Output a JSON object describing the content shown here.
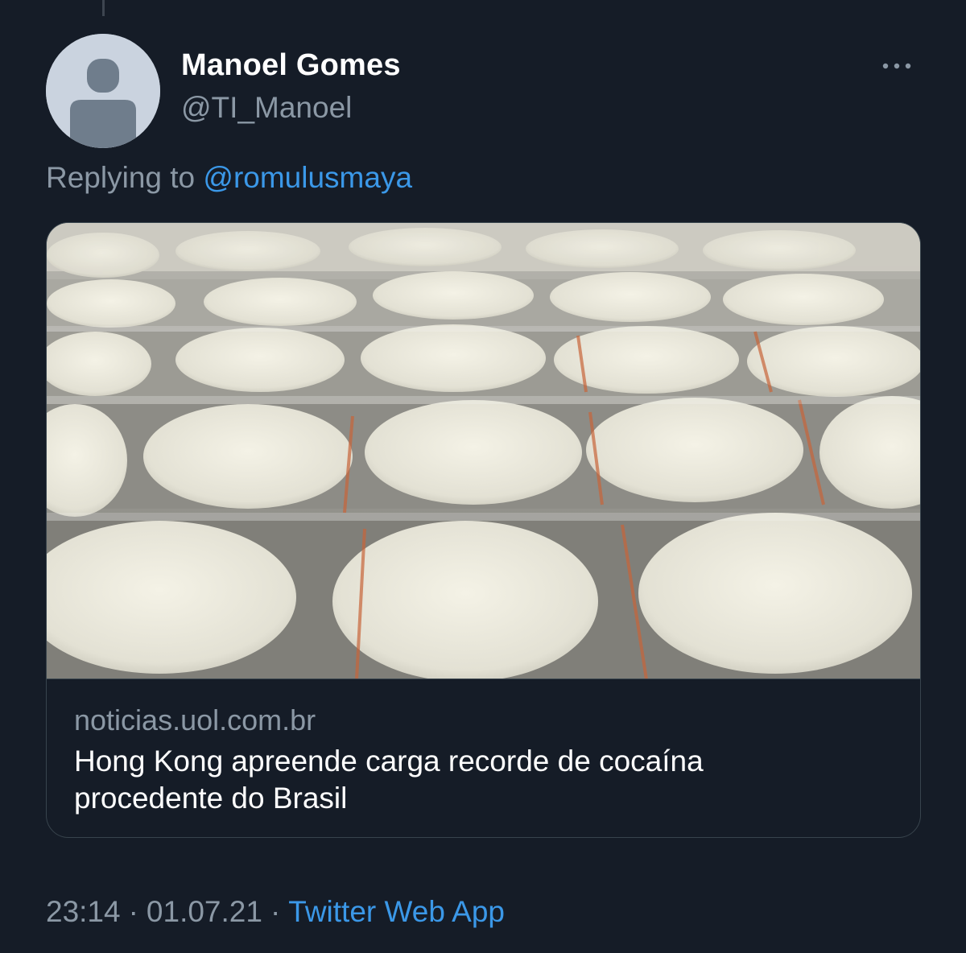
{
  "tweet": {
    "author": {
      "display_name": "Manoel Gomes",
      "handle": "@TI_Manoel",
      "avatar_icon": "default-profile-icon"
    },
    "more_icon": "more-options-icon",
    "reply": {
      "prefix": "Replying to",
      "target": "@romulusmaya"
    },
    "link_card": {
      "image_description_icon": "link-preview-image",
      "domain": "noticias.uol.com.br",
      "title_line1": "Hong Kong apreende carga recorde de cocaína",
      "title_line2": "procedente do Brasil"
    },
    "meta": {
      "time": "23:14",
      "separator": "·",
      "date": "01.07.21",
      "source": "Twitter Web App"
    }
  },
  "colors": {
    "background": "#151c27",
    "primary_text": "#ffffff",
    "secondary_text": "#8b98a5",
    "link": "#3b98e8",
    "border": "#38444d"
  }
}
